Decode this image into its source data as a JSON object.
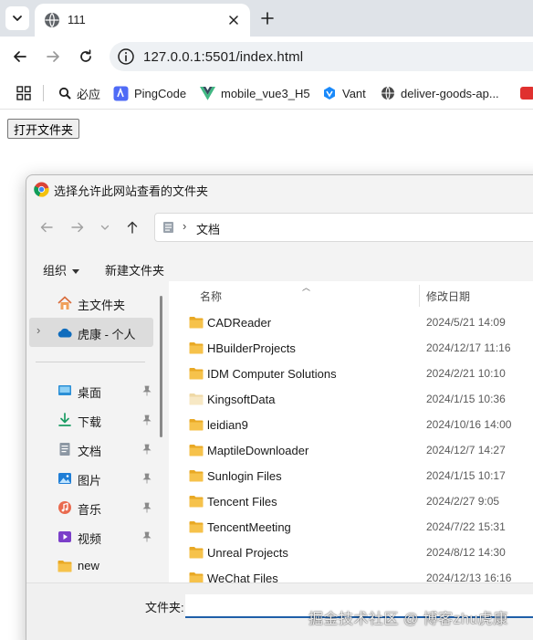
{
  "browser": {
    "tab": {
      "title": "111"
    },
    "url": "127.0.0.1:5501/index.html",
    "bookmarks": [
      {
        "label": "必应",
        "icon": "search-icon"
      },
      {
        "label": "PingCode",
        "icon": "pingcode-icon"
      },
      {
        "label": "mobile_vue3_H5",
        "icon": "vue-icon"
      },
      {
        "label": "Vant",
        "icon": "vant-icon"
      },
      {
        "label": "deliver-goods-ap...",
        "icon": "globe-icon"
      }
    ]
  },
  "page": {
    "open_folder_button": "打开文件夹"
  },
  "dialog": {
    "title": "选择允许此网站查看的文件夹",
    "breadcrumb": "文档",
    "commands": {
      "organize": "组织",
      "new_folder": "新建文件夹"
    },
    "nav": {
      "home": "主文件夹",
      "cloud": "虎康 - 个人",
      "quick": [
        {
          "label": "桌面",
          "icon": "desktop-icon"
        },
        {
          "label": "下载",
          "icon": "download-icon"
        },
        {
          "label": "文档",
          "icon": "document-icon"
        },
        {
          "label": "图片",
          "icon": "pictures-icon"
        },
        {
          "label": "音乐",
          "icon": "music-icon"
        },
        {
          "label": "视频",
          "icon": "video-icon"
        },
        {
          "label": "new",
          "icon": "folder-icon"
        }
      ]
    },
    "columns": {
      "name": "名称",
      "modified": "修改日期"
    },
    "files": [
      {
        "name": "CADReader",
        "date": "2024/5/21 14:09"
      },
      {
        "name": "HBuilderProjects",
        "date": "2024/12/17 11:16"
      },
      {
        "name": "IDM Computer Solutions",
        "date": "2024/2/21 10:10"
      },
      {
        "name": "KingsoftData",
        "date": "2024/1/15 10:36"
      },
      {
        "name": "leidian9",
        "date": "2024/10/16 14:00"
      },
      {
        "name": "MaptileDownloader",
        "date": "2024/12/7 14:27"
      },
      {
        "name": "Sunlogin Files",
        "date": "2024/1/15 10:17"
      },
      {
        "name": "Tencent Files",
        "date": "2024/2/27 9:05"
      },
      {
        "name": "TencentMeeting",
        "date": "2024/7/22 15:31"
      },
      {
        "name": "Unreal Projects",
        "date": "2024/8/12 14:30"
      },
      {
        "name": "WeChat Files",
        "date": "2024/12/13 16:16"
      }
    ],
    "filename_label": "文件夹:",
    "filename_value": ""
  },
  "watermark": "掘金技术社区 @ 博客zhu虎康",
  "colors": {
    "accent": "#1f5fa8",
    "folder": "#f2c14e",
    "onedrive": "#0f6cbd"
  }
}
